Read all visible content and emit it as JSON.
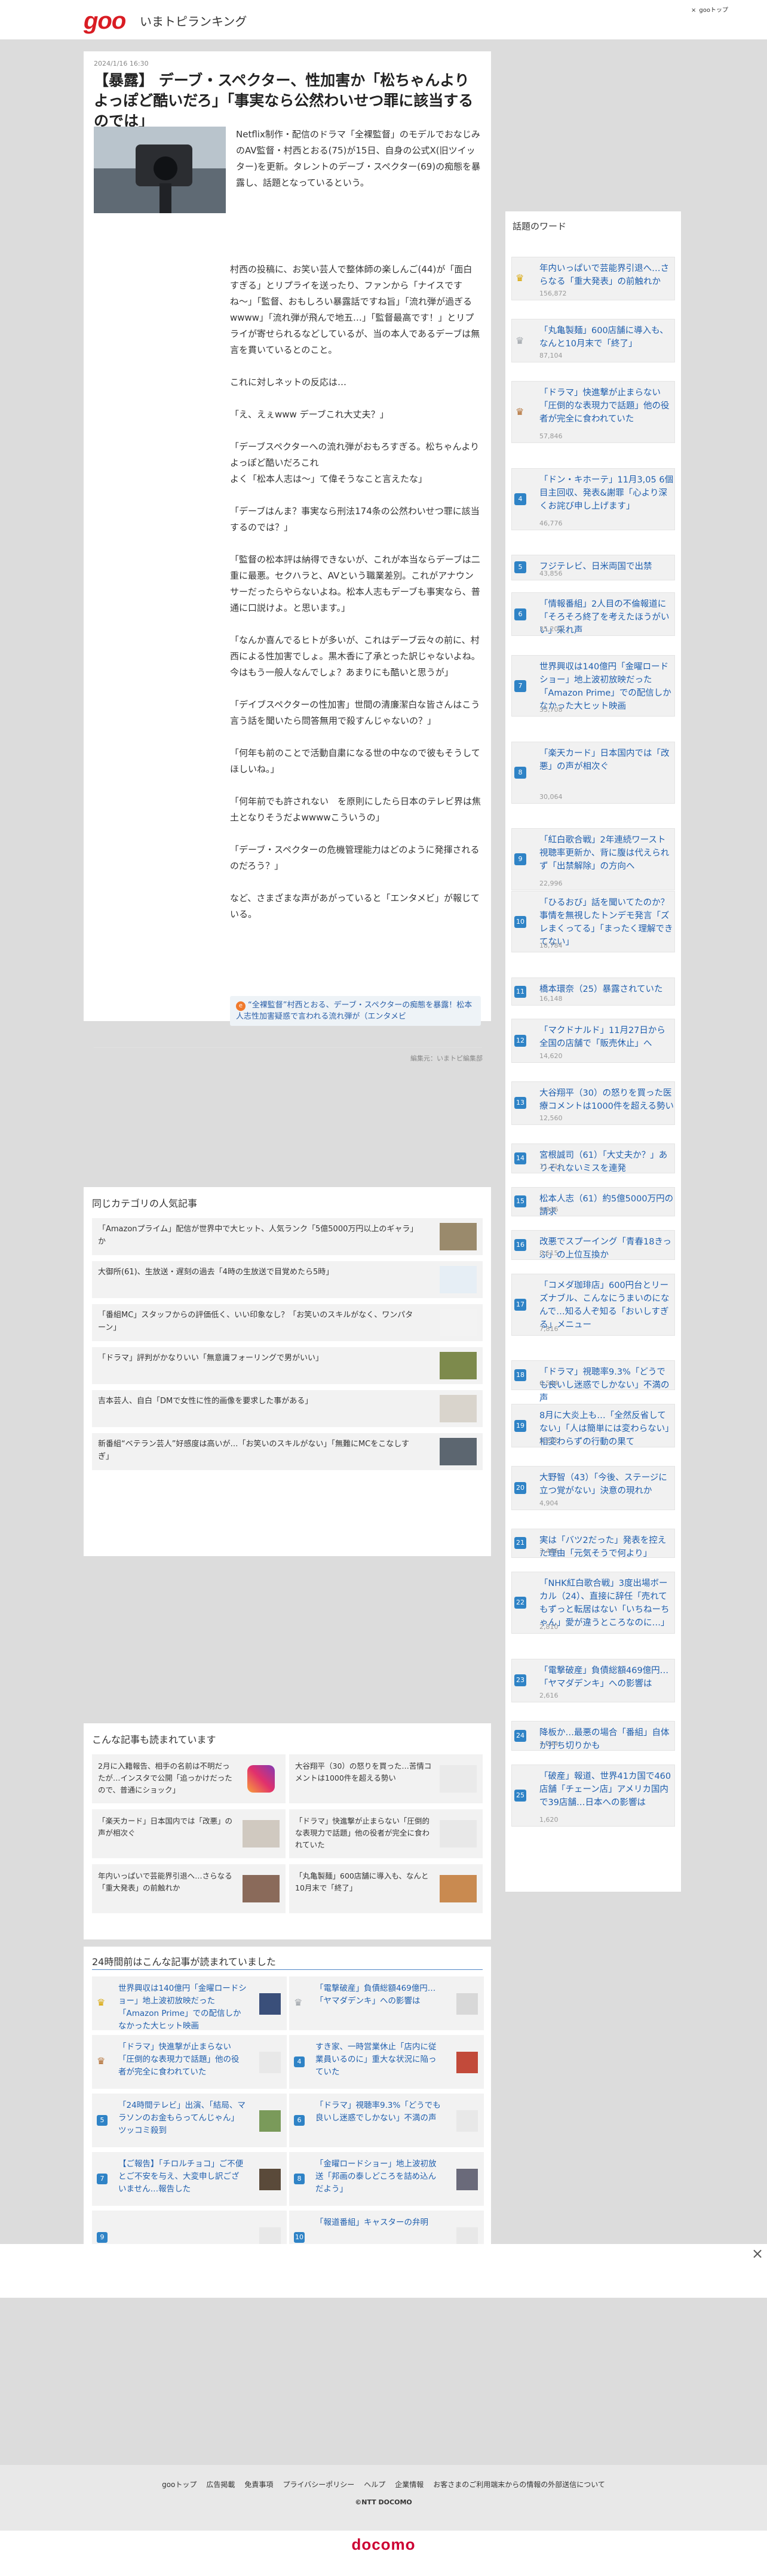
{
  "header": {
    "logo": "goo",
    "site_title": "いまトピランキング",
    "top_link": "gooトップ",
    "top_link_icon": "×"
  },
  "article": {
    "date": "2024/1/16 16:30",
    "title": "【暴露】 デーブ・スペクター、性加害か「松ちゃんよりよっぽど酷いだろ」「事実なら公然わいせつ罪に該当するのでは」",
    "lead": "Netflix制作・配信のドラマ「全裸監督」のモデルでおなじみのAV監督・村西とおる(75)が15日、自身の公式X(旧ツイッター)を更新。タレントのデーブ・スペクター(69)の痴態を暴露し、話題となっているという。",
    "paragraphs": [
      "村西の投稿に、お笑い芸人で整体師の楽しんご(44)が「面白すぎる」とリプライを送ったり、ファンから「ナイスですね〜」「監督、おもしろい暴露話ですね旨」「流れ弾が過ぎるwwww」「流れ弾が飛んで地五…」「監督最高です！」とリプライが寄せられるなどしているが、当の本人であるデーブは無言を貫いているとのこと。",
      "これに対しネットの反応は…",
      "「え、えぇwww デーブこれ大丈夫？」",
      "「デーブスペクターへの流れ弾がおもろすぎる。松ちゃんよりよっぽど酷いだろこれ\nよく「松本人志は〜」て偉そうなこと言えたな」",
      "「デーブはんま？事実なら刑法174条の公然わいせつ罪に該当するのでは？」",
      "「監督の松本評は納得できないが、これが本当ならデーブは二重に最悪。セクハラと、AVという職業差別。これがアナウンサーだったらやらないよね。松本人志もデーブも事実なら、普通に口説けよ。と思います。」",
      "「なんか喜んでるヒトが多いが、これはデーブ云々の前に、村西による性加害でしょ。黒木香に了承とった訳じゃないよね。今はもう一般人なんでしょ？あまりにも酷いと思うが」",
      "「デイブスペクターの性加害」世間の清廉潔白な皆さんはこう言う話を聞いたら問答無用で殺すんじゃないの？」",
      "「何年も前のことで活動自粛になる世の中なので彼もそうしてほしいね。」",
      "「何年前でも許されない　を原則にしたら日本のテレビ界は焦土となりそうだよwwwwこういうの」",
      "「デーブ・スペクターの危機管理能力はどのように発揮されるのだろう？」",
      "など、さまざまな声があがっていると「エンタメビ」が報じている。"
    ],
    "related_link": "“全裸監督”村西とおる、デーブ・スペクターの痴態を暴露！松本人志性加害疑惑で言われる流れ弾が（エンタメビ",
    "related_link_icon": "e",
    "source": "編集元：いまトピ編集部"
  },
  "sidebar": {
    "title": "話題のワード",
    "items": [
      {
        "rank": "1",
        "badge": "crown-gold",
        "title": "年内いっぱいで芸能界引退へ…さらなる「重大発表」の前触れか",
        "count": "156,872"
      },
      {
        "rank": "2",
        "badge": "crown-silver",
        "title": "「丸亀製麺」600店舗に導入も、なんと10月末で「終了」",
        "count": "87,104"
      },
      {
        "rank": "3",
        "badge": "crown-bronze",
        "title": "「ドラマ」快進撃が止まらない「圧倒的な表現力で話題」他の役者が完全に食われていた",
        "count": "57,846"
      },
      {
        "rank": "4",
        "badge": "rank",
        "title": "「ドン・キホーテ」11月3,05 6個目主回収、発表&謝罪「心より深くお詫び申し上げます」",
        "count": "46,776"
      },
      {
        "rank": "5",
        "badge": "rank",
        "title": "フジテレビ、日米両国で出禁",
        "count": "43,856"
      },
      {
        "rank": "6",
        "badge": "rank",
        "title": "「情報番組」2人目の不倫報道に「そろそろ終了を考えたほうがいい」采れ声",
        "count": "35,200"
      },
      {
        "rank": "7",
        "badge": "rank",
        "title": "世界興収は140億円「金曜ロードショー」地上波初放映だった「Amazon Prime」での配信しかなかった大ヒット映画",
        "count": "33,708"
      },
      {
        "rank": "8",
        "badge": "rank",
        "title": "「楽天カード」日本国内では「改悪」の声が相次ぐ",
        "count": "30,064"
      },
      {
        "rank": "9",
        "badge": "rank",
        "title": "「紅白歌合戦」2年連続ワースト視聴率更新か、背に腹は代えられず「出禁解除」の方向へ",
        "count": "22,996"
      },
      {
        "rank": "10",
        "badge": "rank",
        "title": "「ひるおび」話を聞いてたのか？事情を無視したトンデモ発言「ズレまくってる」「まったく理解できてない」",
        "count": "18,784"
      },
      {
        "rank": "11",
        "badge": "rank",
        "title": "橋本環奈（25）暴露されていた",
        "count": "16,148"
      },
      {
        "rank": "12",
        "badge": "rank",
        "title": "「マクドナルド」11月27日から全国の店舗で「販売休止」へ",
        "count": "14,620"
      },
      {
        "rank": "13",
        "badge": "rank",
        "title": "大谷翔平（30）の怒りを買った医療コメントは1000件を超える勢い",
        "count": "12,560"
      },
      {
        "rank": "14",
        "badge": "rank",
        "title": "宮根誠司（61）「大丈夫か？」ありそれないミスを連発",
        "count": "11,312"
      },
      {
        "rank": "15",
        "badge": "rank",
        "title": "松本人志（61）約5億5000万円の請求",
        "count": "9,936"
      },
      {
        "rank": "16",
        "badge": "rank",
        "title": "改悪でスプーイング「青春18きっぷ」の上位互換か",
        "count": "8,615"
      },
      {
        "rank": "17",
        "badge": "rank",
        "title": "「コメダ珈琲店」600円台とリーズナブル、こんなにうまいのになんで…知る人ぞ知る「おいしすぎる」メニュー",
        "count": "7,816"
      },
      {
        "rank": "18",
        "badge": "rank",
        "title": "「ドラマ」視聴率9.3%「どうでも良いし迷惑でしかない」不満の声",
        "count": "6,544"
      },
      {
        "rank": "19",
        "badge": "rank",
        "title": "8月に大炎上も…「全然反省してない」「人は簡単には変わらない」相変わらずの行動の果て",
        "count": "5,232"
      },
      {
        "rank": "20",
        "badge": "rank",
        "title": "大野智（43）「今後、ステージに立つ覚がない」決意の現れか",
        "count": "4,904"
      },
      {
        "rank": "21",
        "badge": "rank",
        "title": "実は「バツ2だった」発表を控えた理由「元気そうで何より」",
        "count": "3,466"
      },
      {
        "rank": "22",
        "badge": "rank",
        "title": "「NHK紅白歌合戦」3度出場ボーカル（24）、直接に辞任「売れてもずっと転居はない「いちねーちゃん」愛が違うところなのに…」",
        "count": "2,810"
      },
      {
        "rank": "23",
        "badge": "rank",
        "title": "「電撃破産」負債総額469億円…「ヤマダデンキ」への影響は",
        "count": "2,616"
      },
      {
        "rank": "24",
        "badge": "rank",
        "title": "降板か…最悪の場合「番組」自体が打ち切りかも",
        "count": "1,744"
      },
      {
        "rank": "25",
        "badge": "rank",
        "title": "「破産」報道、世界41カ国で460店舗「チェーン店」アメリカ国内で39店舗…日本への影響は",
        "count": "1,620"
      }
    ]
  },
  "same_category": {
    "title": "同じカテゴリの人気記事",
    "items": [
      {
        "text": "「Amazonプライム」配信が世界中で大ヒット、人気ランク「5億5000万円以上のギャラ」か",
        "thumb_color": "#9a8a6c"
      },
      {
        "text": "大御所(61)、生放送・遅刻の過去「4時の生放送で目覚めたら5時」",
        "thumb_color": "#e6eef5"
      },
      {
        "text": "「番組MC」スタッフからの評価低く、いい印象なし？「お笑いのスキルがなく、ワンパターン」",
        "thumb_color": "#f3f3f3"
      },
      {
        "text": "「ドラマ」評判がかなりいい「無意識フォーリングで男がいい」",
        "thumb_color": "#7d8a4c"
      },
      {
        "text": "吉本芸人、自白「DMで女性に性的画像を要求した事がある」",
        "thumb_color": "#d9d4cc"
      },
      {
        "text": "新番組“ベテラン芸人”好感度は高いが…「お笑いのスキルがない」「無難にMCをこなしすぎ」",
        "thumb_color": "#5c6670"
      }
    ]
  },
  "also_read": {
    "title": "こんな記事も読まれています",
    "items": [
      {
        "text": "2月に入籍報告、相手の名前は不明だったが…インスタで公開「追っかけだったので、普通にショック」",
        "thumb_color": "instagram"
      },
      {
        "text": "大谷翔平（30）の怒りを買った…苦情コメントは1000件を超える勢い",
        "thumb_color": "#eaeaea"
      },
      {
        "text": "「楽天カード」日本国内では「改悪」の声が相次ぐ",
        "thumb_color": "#d0c9c0"
      },
      {
        "text": "「ドラマ」快進撃が止まらない「圧倒的な表現力で話題」他の役者が完全に食われていた",
        "thumb_color": "#e8e8e8"
      },
      {
        "text": "年内いっぱいで芸能界引退へ…さらなる「重大発表」の前触れか",
        "thumb_color": "#8a6a5a"
      },
      {
        "text": "「丸亀製麺」600店舗に導入も、なんと10月末で「終了」",
        "thumb_color": "#c98a50"
      }
    ]
  },
  "h24": {
    "title": "24時間前はこんな記事が読まれていました",
    "items": [
      {
        "rank": "1",
        "badge": "crown-gold",
        "text": "世界興収は140億円「金曜ロードショー」地上波初放映だった「Amazon Prime」での配信しかなかった大ヒット映画",
        "thumb_color": "#3a4f7a"
      },
      {
        "rank": "2",
        "badge": "crown-silver",
        "text": "「電撃破産」負債総額469億円…「ヤマダデンキ」への影響は",
        "thumb_color": "#d8d8d8"
      },
      {
        "rank": "3",
        "badge": "crown-bronze",
        "text": "「ドラマ」快進撃が止まらない「圧倒的な表現力で話題」他の役者が完全に食われていた",
        "thumb_color": "#e8e8e8"
      },
      {
        "rank": "4",
        "badge": "rank",
        "text": "すき家、一時営業休止「店内に従業員いるのに」重大な状況に陥っていた",
        "thumb_color": "#c24a3a"
      },
      {
        "rank": "5",
        "badge": "rank",
        "text": "「24時間テレビ」出演、「結局、マラソンのお金もらってんじゃん」ツッコミ殺到",
        "thumb_color": "#7a9a5a"
      },
      {
        "rank": "6",
        "badge": "rank",
        "text": "「ドラマ」視聴率9.3%「どうでも良いし迷惑でしかない」不満の声",
        "thumb_color": "#e8e8e8"
      },
      {
        "rank": "7",
        "badge": "rank",
        "text": "【ご報告】「チロルチョコ」ご不便とご不安を与え、大変申し訳ございません…報告した",
        "thumb_color": "#5a4a3a"
      },
      {
        "rank": "8",
        "badge": "rank",
        "text": "「金曜ロードショー」地上波初放送「邦画の泰しどころを詰め込んだよう」",
        "thumb_color": "#6a6a7a"
      },
      {
        "rank": "9",
        "badge": "rank",
        "text": "",
        "thumb_color": "#e8e8e8"
      },
      {
        "rank": "10",
        "badge": "rank",
        "text": "「報道番組」キャスターの弁明",
        "thumb_color": "#e8e8e8"
      }
    ]
  },
  "ad": {
    "close_icon": "×"
  },
  "footer": {
    "links": [
      "gooトップ",
      "広告掲載",
      "免責事項",
      "プライバシーポリシー",
      "ヘルプ",
      "企業情報",
      "お客さまのご利用端末からの情報の外部送信について"
    ],
    "copyright": "©NTT DOCOMO",
    "brand": "docomo"
  }
}
